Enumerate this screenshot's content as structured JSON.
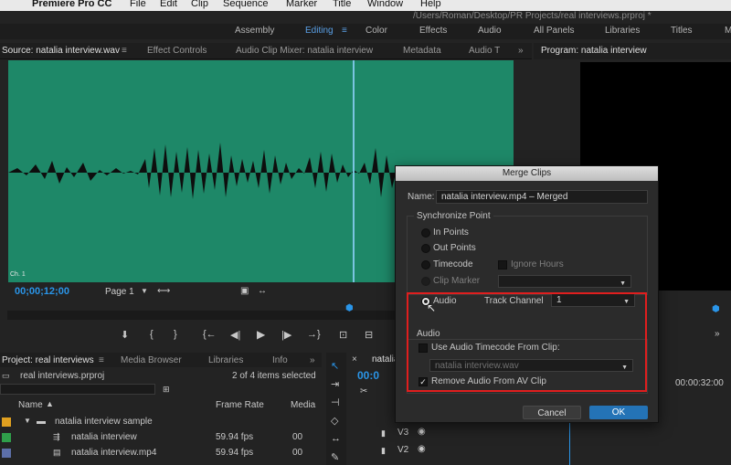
{
  "menubar": {
    "app_name": "Premiere Pro CC",
    "items": [
      "File",
      "Edit",
      "Clip",
      "Sequence",
      "Marker",
      "Title",
      "Window",
      "Help"
    ]
  },
  "project_path": "/Users/Roman/Desktop/PR Projects/real interviews.prproj *",
  "workspaces": [
    "Assembly",
    "Editing",
    "Color",
    "Effects",
    "Audio",
    "All Panels",
    "Libraries",
    "Titles",
    "M"
  ],
  "active_workspace": "Editing",
  "source_panel": {
    "tabs": [
      "Source: natalia interview.wav",
      "Effect Controls",
      "Audio Clip Mixer: natalia interview",
      "Metadata",
      "Audio T"
    ],
    "channel_label": "Ch. 1",
    "timecode": "00;00;12;00",
    "page_select": "Page 1"
  },
  "program_panel": {
    "title": "Program: natalia interview"
  },
  "project_panel": {
    "tabs": [
      "Project: real interviews",
      "Media Browser",
      "Libraries",
      "Info"
    ],
    "file": "real interviews.prproj",
    "selection_status": "2 of 4 items selected",
    "columns": [
      "Name",
      "Frame Rate",
      "Media"
    ],
    "rows": [
      {
        "name": "natalia interview sample",
        "fps": "",
        "media": "",
        "color": "#e0a020"
      },
      {
        "name": "natalia interview",
        "fps": "59.94 fps",
        "media": "00",
        "color": "#2f9e4a"
      },
      {
        "name": "natalia interview.mp4",
        "fps": "59.94 fps",
        "media": "00",
        "color": "#5d6fa8"
      }
    ]
  },
  "timeline": {
    "tab": "natalia",
    "timecode": "00:0",
    "ruler_time": "00:00:32:00",
    "tracks": [
      "V3",
      "V2"
    ]
  },
  "dialog": {
    "title": "Merge Clips",
    "name_label": "Name:",
    "name_value": "natalia interview.mp4 – Merged",
    "sync_group_label": "Synchronize Point",
    "options": [
      {
        "label": "In Points",
        "selected": false,
        "enabled": true
      },
      {
        "label": "Out Points",
        "selected": false,
        "enabled": true
      },
      {
        "label": "Timecode",
        "selected": false,
        "enabled": true
      },
      {
        "label": "Clip Marker",
        "selected": false,
        "enabled": false
      },
      {
        "label": "Audio",
        "selected": true,
        "enabled": true
      }
    ],
    "ignore_hours_label": "Ignore Hours",
    "track_channel_label": "Track Channel",
    "track_channel_value": "1",
    "audio_group_label": "Audio",
    "use_audio_tc_label": "Use Audio Timecode From Clip:",
    "use_audio_tc_checked": false,
    "audio_clip_value": "natalia interview.wav",
    "remove_audio_label": "Remove Audio From AV Clip",
    "remove_audio_checked": true,
    "cancel_label": "Cancel",
    "ok_label": "OK"
  },
  "colors": {
    "waveform_bg": "#1e8868",
    "accent_blue": "#2a95e8",
    "highlight_red": "#e01e1e",
    "ok_button": "#2473b6"
  }
}
